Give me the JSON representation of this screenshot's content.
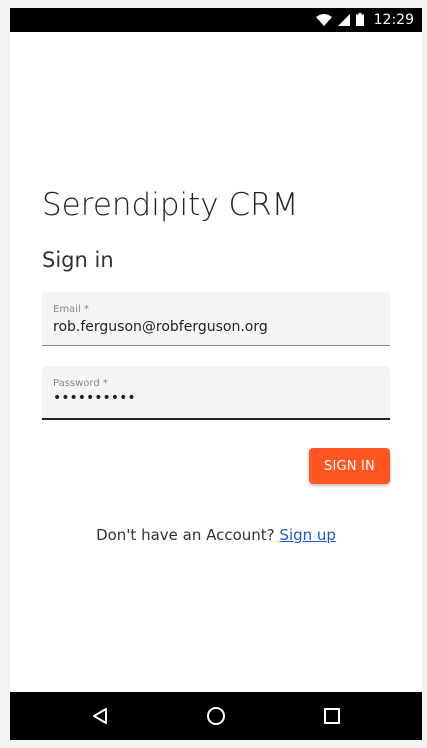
{
  "status_bar": {
    "time": "12:29",
    "icons": [
      "wifi-icon",
      "cell-signal-icon",
      "battery-icon"
    ]
  },
  "app": {
    "title": "Serendipity CRM",
    "heading": "Sign in"
  },
  "form": {
    "email": {
      "label": "Email *",
      "value": "rob.ferguson@robferguson.org"
    },
    "password": {
      "label": "Password *",
      "masked_value": "••••••••••"
    },
    "submit_label": "SIGN IN"
  },
  "signup": {
    "prompt": "Don't have an Account?",
    "link_label": "Sign up"
  },
  "nav_bar": {
    "buttons": [
      "back-icon",
      "home-icon",
      "recents-icon"
    ]
  },
  "colors": {
    "accent": "#ff5722",
    "link": "#1a5ad7",
    "field_bg": "#f5f5f5"
  }
}
